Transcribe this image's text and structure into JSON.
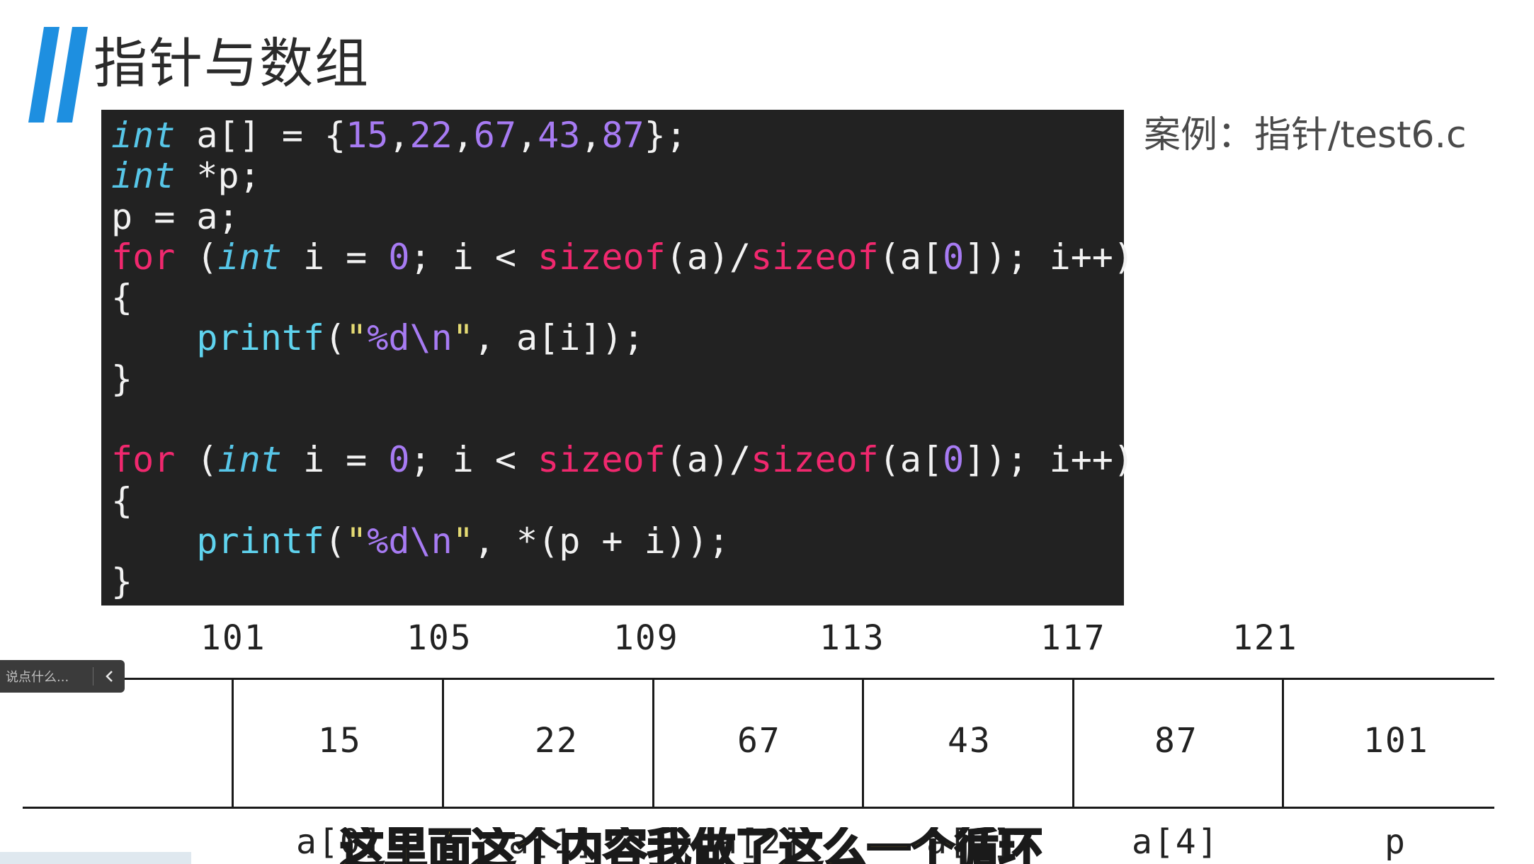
{
  "slide": {
    "title": "指针与数组",
    "case_label": "案例：指针/test6.c",
    "accent_color": "#1e8fe0"
  },
  "code_lines": [
    [
      {
        "t": "int",
        "c": "kw-type"
      },
      {
        "t": " a[] = {"
      },
      {
        "t": "15",
        "c": "num"
      },
      {
        "t": ","
      },
      {
        "t": "22",
        "c": "num"
      },
      {
        "t": ","
      },
      {
        "t": "67",
        "c": "num"
      },
      {
        "t": ","
      },
      {
        "t": "43",
        "c": "num"
      },
      {
        "t": ","
      },
      {
        "t": "87",
        "c": "num"
      },
      {
        "t": "};"
      }
    ],
    [
      {
        "t": "int",
        "c": "kw-type"
      },
      {
        "t": " *p;"
      }
    ],
    [
      {
        "t": "p = a;"
      }
    ],
    [
      {
        "t": "for",
        "c": "kw-for"
      },
      {
        "t": " ("
      },
      {
        "t": "int",
        "c": "kw-type"
      },
      {
        "t": " i = "
      },
      {
        "t": "0",
        "c": "num"
      },
      {
        "t": "; i < "
      },
      {
        "t": "sizeof",
        "c": "kw-fn"
      },
      {
        "t": "(a)/"
      },
      {
        "t": "sizeof",
        "c": "kw-fn"
      },
      {
        "t": "(a["
      },
      {
        "t": "0",
        "c": "num"
      },
      {
        "t": "]); i++)"
      }
    ],
    [
      {
        "t": "{"
      }
    ],
    [
      {
        "t": "    "
      },
      {
        "t": "printf",
        "c": "call"
      },
      {
        "t": "("
      },
      {
        "t": "\"",
        "c": "str"
      },
      {
        "t": "%d\\n",
        "c": "esc"
      },
      {
        "t": "\"",
        "c": "str"
      },
      {
        "t": ", a[i]);"
      }
    ],
    [
      {
        "t": "}"
      }
    ],
    [
      {
        "t": ""
      }
    ],
    [
      {
        "t": "for",
        "c": "kw-for"
      },
      {
        "t": " ("
      },
      {
        "t": "int",
        "c": "kw-type"
      },
      {
        "t": " i = "
      },
      {
        "t": "0",
        "c": "num"
      },
      {
        "t": "; i < "
      },
      {
        "t": "sizeof",
        "c": "kw-fn"
      },
      {
        "t": "(a)/"
      },
      {
        "t": "sizeof",
        "c": "kw-fn"
      },
      {
        "t": "(a["
      },
      {
        "t": "0",
        "c": "num"
      },
      {
        "t": "]); i++)"
      }
    ],
    [
      {
        "t": "{"
      }
    ],
    [
      {
        "t": "    "
      },
      {
        "t": "printf",
        "c": "call"
      },
      {
        "t": "("
      },
      {
        "t": "\"",
        "c": "str"
      },
      {
        "t": "%d\\n",
        "c": "esc"
      },
      {
        "t": "\"",
        "c": "str"
      },
      {
        "t": ", *(p + i));"
      }
    ],
    [
      {
        "t": "}"
      }
    ]
  ],
  "memory": {
    "addresses": [
      "101",
      "105",
      "109",
      "113",
      "117",
      "121"
    ],
    "values": [
      "15",
      "22",
      "67",
      "43",
      "87",
      "101"
    ],
    "labels": [
      "a[0]",
      "a[1]",
      "a[2]",
      "a[3]",
      "a[4]",
      "p"
    ]
  },
  "comment_box": {
    "placeholder": "说点什么...",
    "collapse_icon": "chevron-left-icon"
  },
  "subtitle": "这里面这个内容我做了这么一个循环"
}
